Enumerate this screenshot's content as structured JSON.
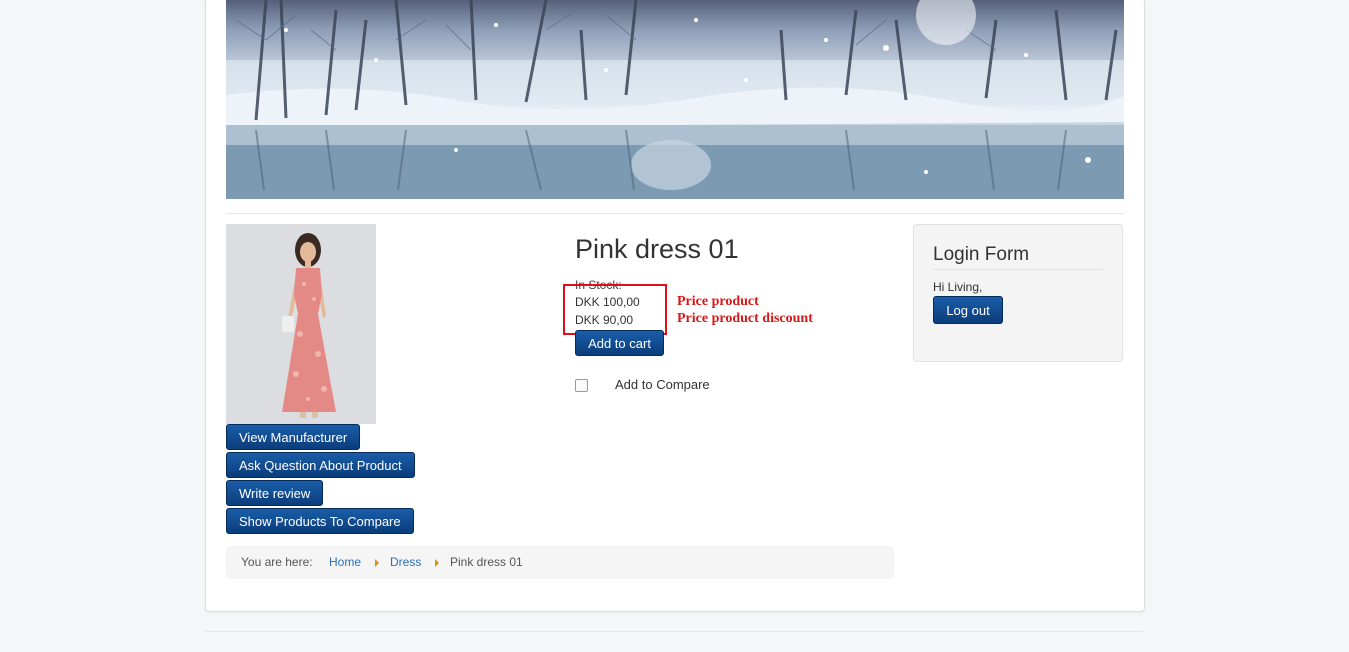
{
  "product": {
    "title": "Pink dress 01",
    "stock": "In Stock:",
    "price": "DKK 100,00",
    "discount_price": "DKK 90,00",
    "add_to_cart": "Add to cart",
    "add_to_compare": "Add to Compare"
  },
  "annotations": {
    "price_label": "Price product",
    "discount_label": "Price product discount",
    "color": "#d71818"
  },
  "actions": {
    "view_manufacturer": "View Manufacturer",
    "ask_question": "Ask Question About Product",
    "write_review": "Write review",
    "show_compare": "Show Products To Compare"
  },
  "breadcrumb": {
    "prefix": "You are here:",
    "items": [
      "Home",
      "Dress",
      "Pink dress 01"
    ]
  },
  "login": {
    "title": "Login Form",
    "greeting": "Hi Living,",
    "logout": "Log out"
  },
  "colors": {
    "button": "#0b3d7b",
    "link": "#2d6fb5",
    "separator": "#e38b17"
  }
}
